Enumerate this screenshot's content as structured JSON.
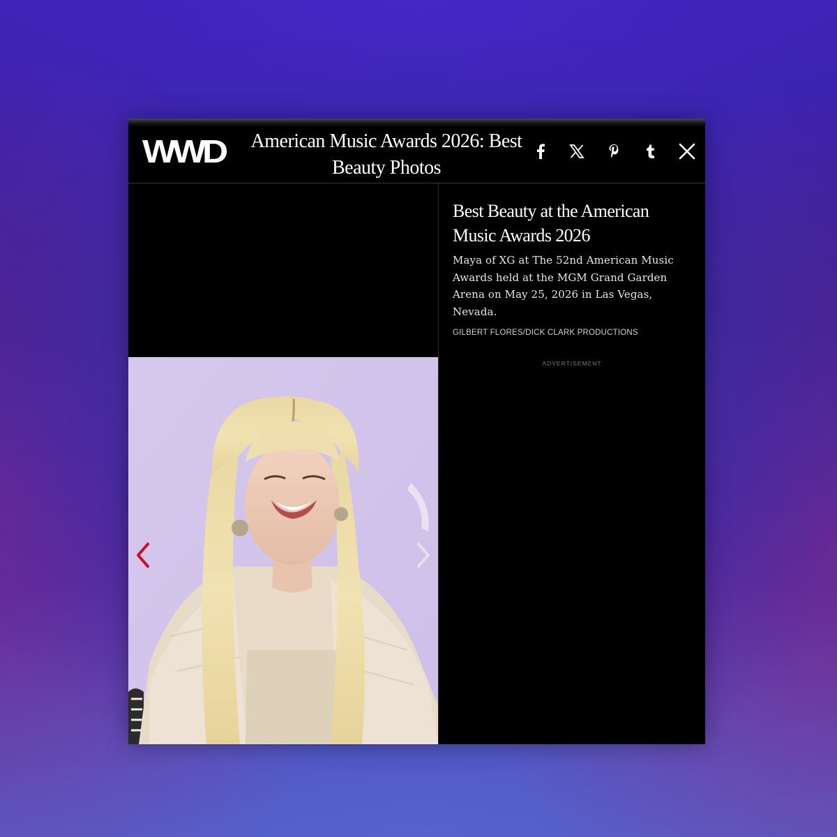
{
  "header": {
    "logo": "WWD",
    "gallery_title": "American Music Awards 2026: Best Beauty Photos",
    "share_icons": [
      "facebook-icon",
      "x-icon",
      "pinterest-icon",
      "tumblr-icon"
    ],
    "close_icon": "close-icon"
  },
  "slide": {
    "title": "Best Beauty at the American Music Awards 2026",
    "caption": "Maya of XG at The 52nd American Music Awards held at the MGM Grand Garden Arena on May 25, 2026 in Las Vegas, Nevada.",
    "credit": "GILBERT FLORES/DICK CLARK PRODUCTIONS",
    "advertisement_label": "ADVERTISEMENT"
  },
  "photo": {
    "subject": "photo"
  },
  "colors": {
    "accent": "#c8102e",
    "background": "#000000",
    "text": "#ffffff"
  }
}
